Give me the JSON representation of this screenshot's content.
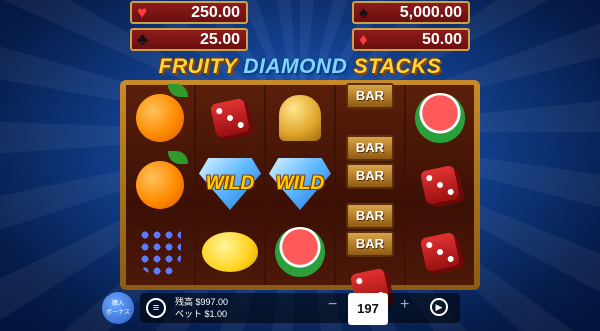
{
  "jackpots": [
    {
      "suit": "hearts",
      "suit_symbol": "♥",
      "color": "#ff3b3b",
      "value": "250.00"
    },
    {
      "suit": "spades",
      "suit_symbol": "♠",
      "color": "#111111",
      "value": "5,000.00"
    },
    {
      "suit": "clubs",
      "suit_symbol": "♣",
      "color": "#111111",
      "value": "25.00"
    },
    {
      "suit": "diamonds",
      "suit_symbol": "♦",
      "color": "#ff3b3b",
      "value": "50.00"
    }
  ],
  "title": {
    "part1": "FRUITY ",
    "part2": "DIAMOND",
    "part3": " STACKS"
  },
  "wild_label": "WILD",
  "bar_label": "BAR",
  "bonus_label": [
    "購入",
    "ボーナス"
  ],
  "balance": {
    "label": "残高",
    "value": "$997.00"
  },
  "bet": {
    "label": "ベット",
    "value": "$1.00"
  },
  "bet_counter": "197",
  "controls": {
    "menu_icon": "menu-icon",
    "minus": "−",
    "plus": "+",
    "spin_icon": "autoplay-icon"
  }
}
